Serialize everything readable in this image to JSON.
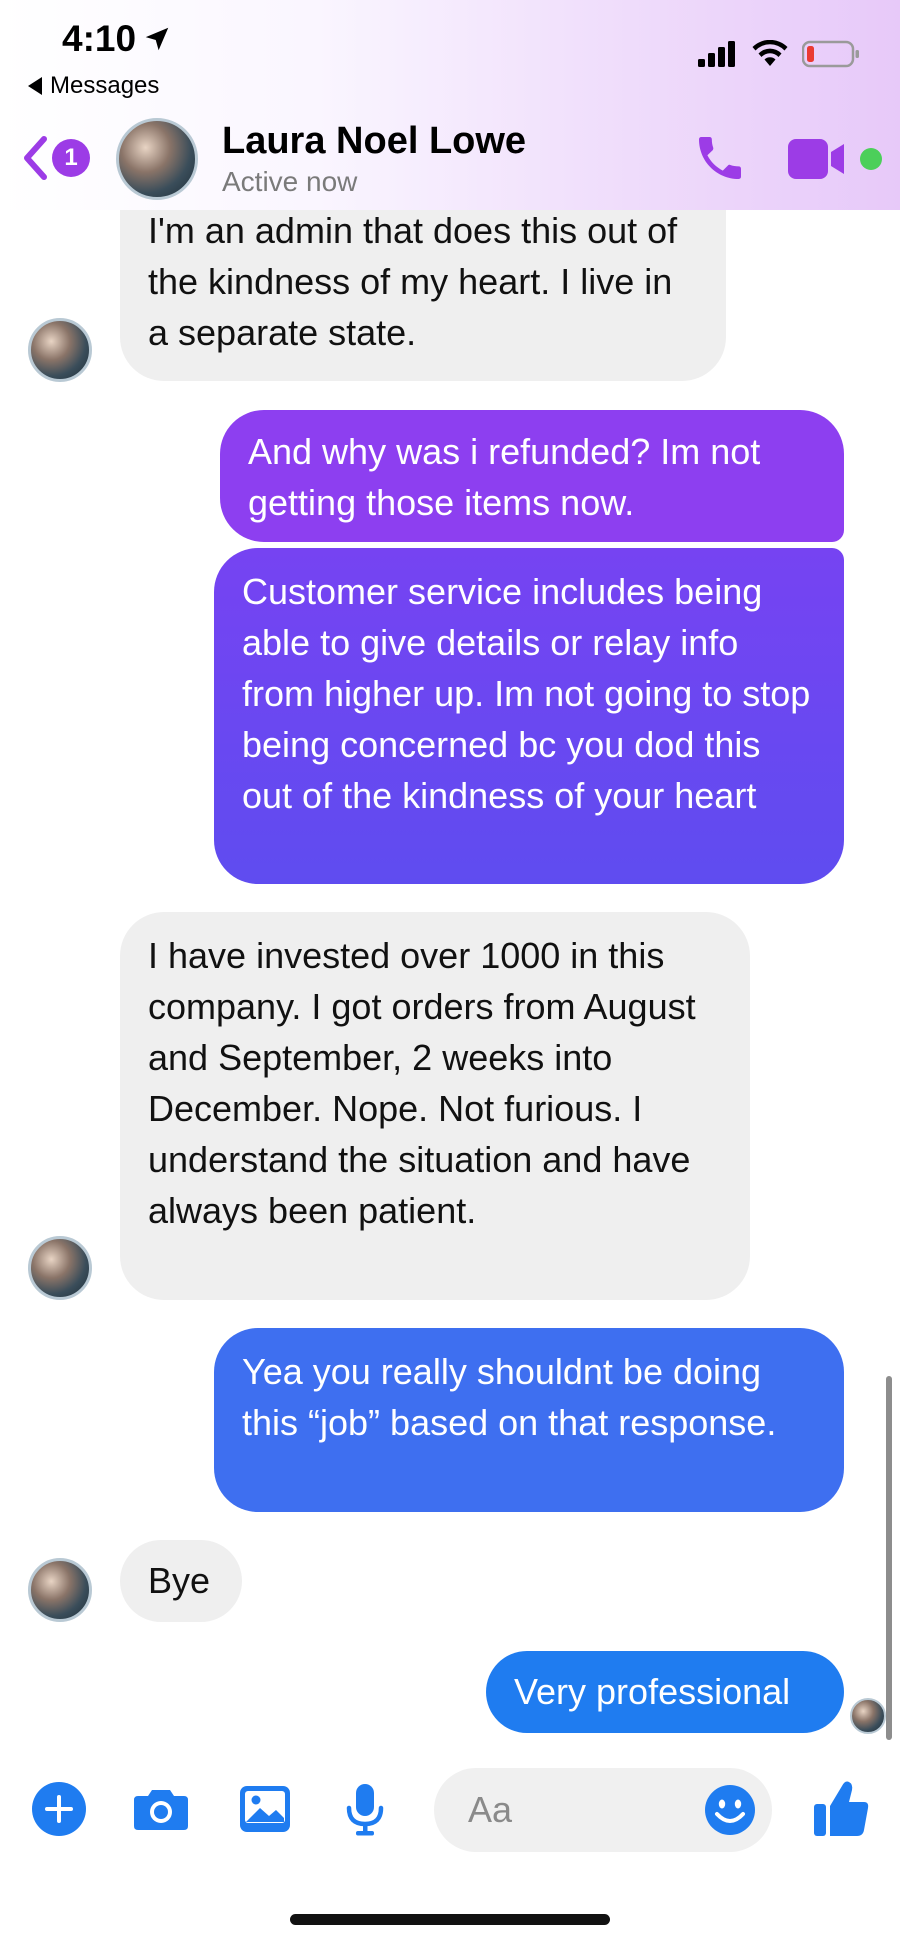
{
  "status_bar": {
    "time": "4:10",
    "back_app": "Messages"
  },
  "header": {
    "contact_name": "Laura Noel Lowe",
    "contact_status": "Active now",
    "unread_count": "1"
  },
  "messages": [
    {
      "sender": "contact",
      "text": "I'm an admin that does this out of the kindness of my heart. I live in a separate state."
    },
    {
      "sender": "me",
      "text": "And why was i refunded? Im not getting those items now."
    },
    {
      "sender": "me",
      "text": "Customer service includes being able to give details or relay info from higher up. Im not going to stop being concerned bc you dod this out of the kindness of your heart"
    },
    {
      "sender": "contact",
      "text": "I have invested over 1000 in this company. I got orders from August and September, 2 weeks into December. Nope. Not furious. I understand the situation and have always been patient."
    },
    {
      "sender": "me",
      "text": "Yea you really shouldnt be doing this “job” based on that response."
    },
    {
      "sender": "contact",
      "text": "Bye"
    },
    {
      "sender": "me",
      "text": "Very professional"
    }
  ],
  "composer": {
    "placeholder": "Aa"
  },
  "colors": {
    "accent_purple": "#9c3ce6",
    "messenger_blue": "#1f7cf0",
    "online_green": "#4ccf5a",
    "incoming_bubble": "#efefef"
  },
  "icons": [
    "location-arrow-icon",
    "signal-icon",
    "wifi-icon",
    "battery-icon",
    "chevron-left-icon",
    "phone-icon",
    "video-icon",
    "plus-icon",
    "camera-icon",
    "photo-icon",
    "microphone-icon",
    "emoji-icon",
    "thumbs-up-icon"
  ]
}
